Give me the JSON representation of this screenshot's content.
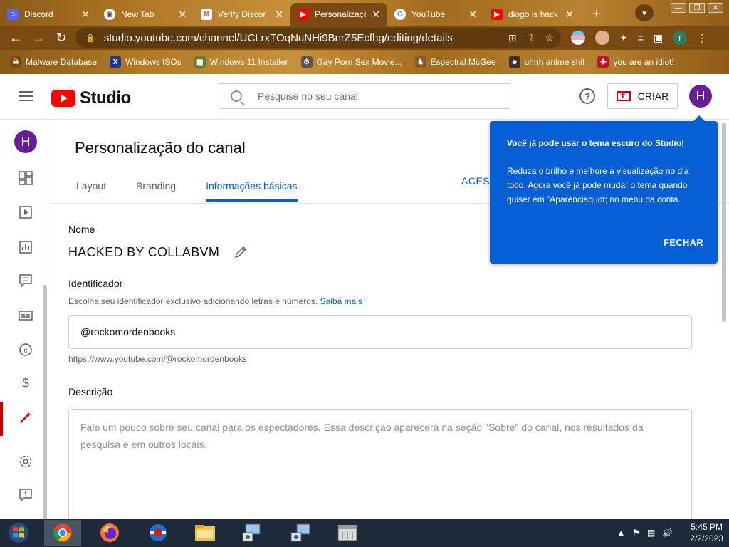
{
  "browser": {
    "tabs": [
      {
        "title": "Discord",
        "icon": "discord-icon",
        "color": "#5865f2"
      },
      {
        "title": "New Tab",
        "icon": "chrome-icon",
        "color": "#9e9e9e"
      },
      {
        "title": "Verify Discor",
        "icon": "gmail-icon",
        "color": "#ea4335"
      },
      {
        "title": "Personalizaçã",
        "icon": "youtube-icon",
        "color": "#ff0000"
      },
      {
        "title": "YouTube",
        "icon": "google-icon",
        "color": "#4285f4"
      },
      {
        "title": "diogo is hack",
        "icon": "youtube-icon",
        "color": "#ff0000"
      }
    ],
    "url": "studio.youtube.com/channel/UCLrxTOqNuNHi9BnrZ5Ecfhg/editing/details",
    "profile_initial": "r",
    "bookmarks": [
      {
        "label": "Malware Database"
      },
      {
        "label": "Windows ISOs"
      },
      {
        "label": "Windows 11 Installer"
      },
      {
        "label": "Gay Porn Sex Movie..."
      },
      {
        "label": "Espectral McGee"
      },
      {
        "label": "uhhh anime shit"
      },
      {
        "label": "you are an idiot!"
      }
    ]
  },
  "header": {
    "logo_text": "Studio",
    "search_placeholder": "Pesquise no seu canal",
    "create_label": "CRIAR",
    "avatar_initial": "H"
  },
  "rail": {
    "avatar_initial": "H"
  },
  "page": {
    "title": "Personalização do canal",
    "tabs": [
      "Layout",
      "Branding",
      "Informações básicas"
    ],
    "active_tab": "Informações básicas",
    "access_link": "ACESS",
    "name_label": "Nome",
    "channel_name": "HACKED BY COLLABVM",
    "handle_label": "Identificador",
    "handle_help": "Escolha seu identificador exclusivo adicionando letras e números.",
    "handle_help_link": "Saiba mais",
    "handle_value": "@rockomordenbooks",
    "handle_url": "https://www.youtube.com/@rockomordenbooks",
    "description_label": "Descrição",
    "description_placeholder": "Fale um pouco sobre seu canal para os espectadores. Essa descrição aparecerá na seção \"Sobre\" do canal, nos resultados da pesquisa e em outros locais."
  },
  "tooltip": {
    "title": "Você já pode usar o tema escuro do Studio!",
    "body": "Reduza o brilho e melhore a visualização no dia todo. Agora você já pode mudar o tema quando quiser em \"Aparênciaquot; no menu da conta.",
    "close_label": "FECHAR"
  },
  "taskbar": {
    "time": "5:45 PM",
    "date": "2/2/2023"
  },
  "colors": {
    "accent": "#065fd4",
    "brand": "#ff0000",
    "avatar": "#6a1b9a"
  }
}
